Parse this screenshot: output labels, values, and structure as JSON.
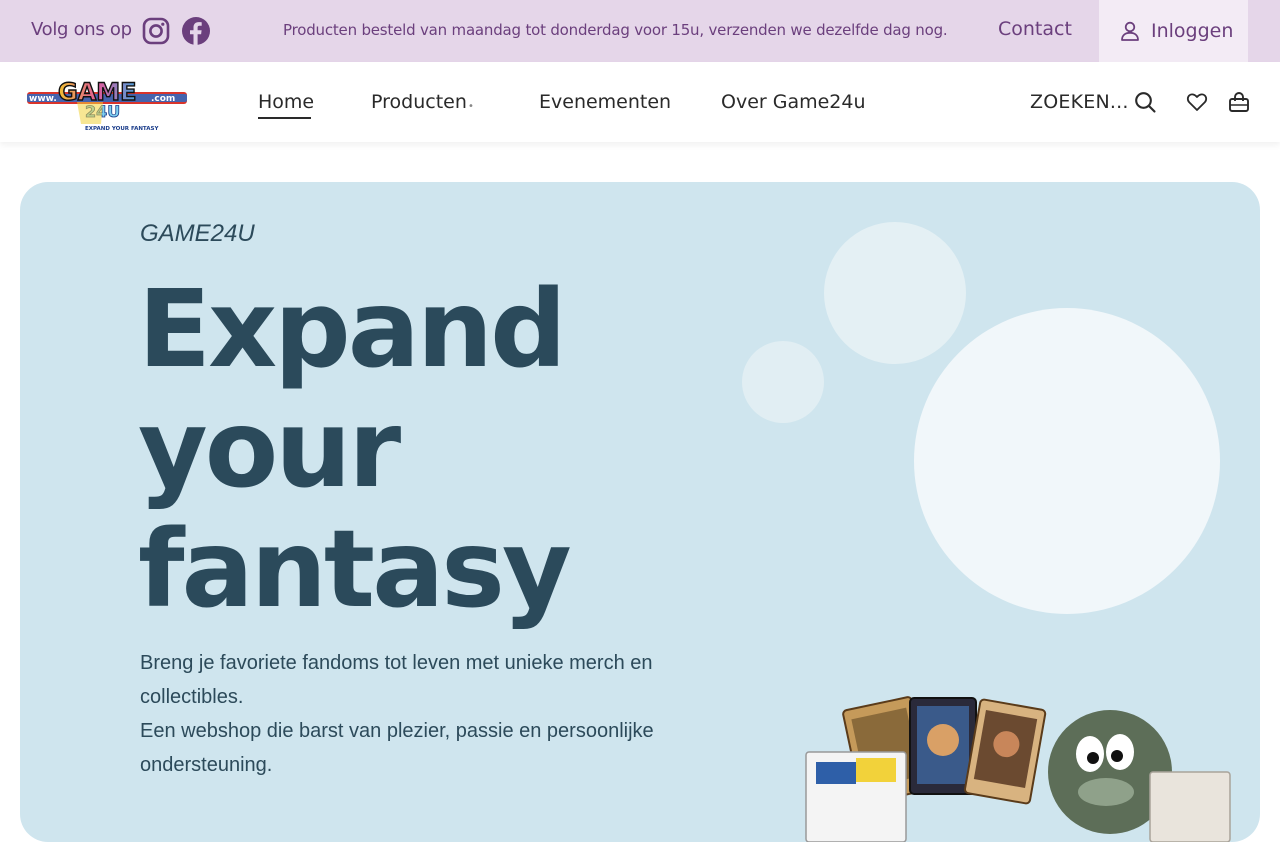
{
  "topbar": {
    "follow_label": "Volg ons op",
    "promo_text": "Producten besteld van maandag tot donderdag voor 15u, verzenden we dezelfde dag nog.",
    "contact_label": "Contact",
    "login_label": "Inloggen",
    "social_icons": [
      "instagram-icon",
      "facebook-icon"
    ],
    "bg_color": "#e5d6e9",
    "text_color": "#6b3f7d"
  },
  "logo": {
    "text_main": "GAME",
    "text_prefix": "www.",
    "text_suffix": ".com",
    "tagline": "EXPAND YOUR FANTASY"
  },
  "nav": {
    "items": [
      {
        "label": "Home",
        "active": true
      },
      {
        "label": "Producten",
        "has_dropdown": true
      },
      {
        "label": "Evenementen"
      },
      {
        "label": "Over Game24u"
      }
    ],
    "search_label": "ZOEKEN...",
    "icons": [
      "search-icon",
      "heart-icon",
      "shopping-bag-icon"
    ]
  },
  "hero": {
    "kicker": "GAME24U",
    "headline": [
      "Expand",
      "your",
      "fantasy"
    ],
    "description_line1": "Breng je favoriete fandoms tot leven met unieke merch en collectibles.",
    "description_line2": "Een webshop die barst van plezier, passie en persoonlijke ondersteuning.",
    "bg_color": "#cfe5ee",
    "headline_color": "#2b4a5b"
  }
}
